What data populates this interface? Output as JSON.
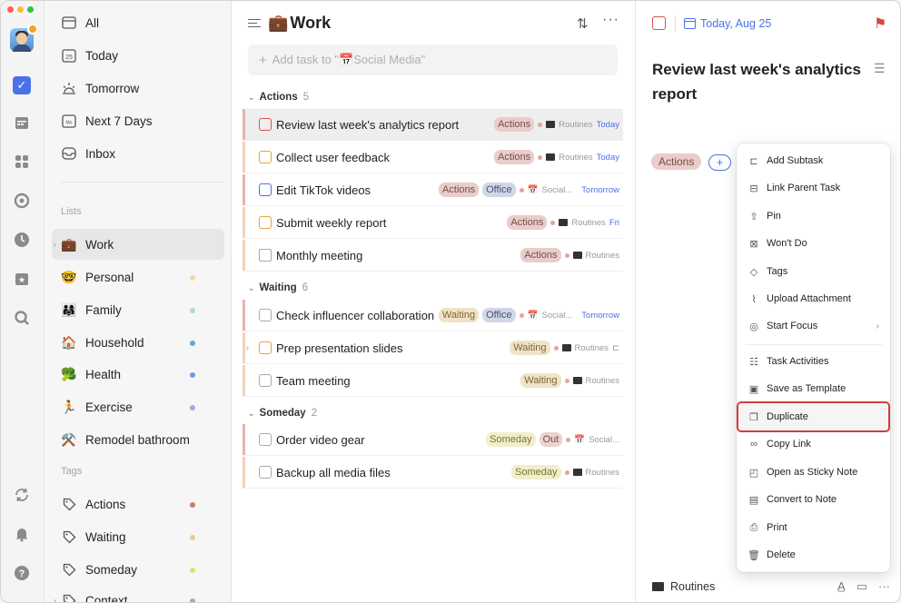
{
  "rail": {
    "icons": [
      "check-square-icon",
      "calendar-icon",
      "grid-icon",
      "focus-icon",
      "clock-icon",
      "calendar-star-icon",
      "search-icon",
      "sync-icon",
      "bell-icon",
      "help-icon"
    ],
    "active_color": "#4a72e8"
  },
  "sidebar": {
    "smart_lists": [
      {
        "label": "All",
        "icon": "tray-icon"
      },
      {
        "label": "Today",
        "icon": "calendar-25-icon"
      },
      {
        "label": "Tomorrow",
        "icon": "sunrise-icon"
      },
      {
        "label": "Next 7 Days",
        "icon": "calendar-week-icon"
      },
      {
        "label": "Inbox",
        "icon": "inbox-icon"
      }
    ],
    "lists_label": "Lists",
    "lists": [
      {
        "label": "Work",
        "emoji": "💼",
        "dot": ""
      },
      {
        "label": "Personal",
        "emoji": "🤓",
        "dot": "#f3d8a2"
      },
      {
        "label": "Family",
        "emoji": "👨‍👩‍👧",
        "dot": "#b8d8cf"
      },
      {
        "label": "Household",
        "emoji": "🏠",
        "dot": "#58a9d9"
      },
      {
        "label": "Health",
        "emoji": "🥦",
        "dot": "#6e9ce8"
      },
      {
        "label": "Exercise",
        "emoji": "🏃",
        "dot": "#b99de6"
      },
      {
        "label": "Remodel bathroom",
        "emoji": "⚒️",
        "dot": ""
      }
    ],
    "tags_label": "Tags",
    "tags": [
      {
        "label": "Actions",
        "dot": "#d47b70"
      },
      {
        "label": "Waiting",
        "dot": "#f0c98e"
      },
      {
        "label": "Someday",
        "dot": "#dde07a"
      },
      {
        "label": "Context",
        "dot": "#aaaaaa"
      }
    ]
  },
  "main": {
    "title": "Work",
    "title_emoji": "💼",
    "add_placeholder": "Add task to \"📅Social Media\"",
    "groups": [
      {
        "name": "Actions",
        "count": "5"
      },
      {
        "name": "Waiting",
        "count": "6"
      },
      {
        "name": "Someday",
        "count": "2"
      }
    ],
    "tasks": [
      {
        "title": "Review last week's analytics report",
        "tags": [
          "Actions"
        ],
        "project": "Routines",
        "due": "Today"
      },
      {
        "title": "Collect user feedback",
        "tags": [
          "Actions"
        ],
        "project": "Routines",
        "due": "Today"
      },
      {
        "title": "Edit TikTok videos",
        "tags": [
          "Actions",
          "Office"
        ],
        "project": "Social...",
        "due": "Tomorrow"
      },
      {
        "title": "Submit weekly report",
        "tags": [
          "Actions"
        ],
        "project": "Routines",
        "due": "Fri"
      },
      {
        "title": "Monthly meeting",
        "tags": [
          "Actions"
        ],
        "project": "Routines",
        "due": ""
      },
      {
        "title": "Check influencer collaboration",
        "tags": [
          "Waiting",
          "Office"
        ],
        "project": "Social...",
        "due": "Tomorrow"
      },
      {
        "title": "Prep presentation slides",
        "tags": [
          "Waiting"
        ],
        "project": "Routines",
        "due": ""
      },
      {
        "title": "Team meeting",
        "tags": [
          "Waiting"
        ],
        "project": "Routines",
        "due": ""
      },
      {
        "title": "Order video gear",
        "tags": [
          "Someday",
          "Out"
        ],
        "project": "Social...",
        "due": ""
      },
      {
        "title": "Backup all media files",
        "tags": [
          "Someday"
        ],
        "project": "Routines",
        "due": ""
      }
    ]
  },
  "detail": {
    "date": "Today, Aug 25",
    "title": "Review last week's analytics report",
    "tag": "Actions",
    "add_tag": "+",
    "project": "Routines",
    "flag_color": "#d9443d"
  },
  "menu": {
    "items": [
      {
        "label": "Add Subtask",
        "icon": "subtask-icon"
      },
      {
        "label": "Link Parent Task",
        "icon": "link-parent-icon"
      },
      {
        "label": "Pin",
        "icon": "pin-icon"
      },
      {
        "label": "Won't Do",
        "icon": "x-box-icon"
      },
      {
        "label": "Tags",
        "icon": "tag-icon"
      },
      {
        "label": "Upload Attachment",
        "icon": "paperclip-icon"
      },
      {
        "label": "Start Focus",
        "icon": "focus-icon"
      },
      {
        "label": "Task Activities",
        "icon": "activities-icon"
      },
      {
        "label": "Save as Template",
        "icon": "template-icon"
      },
      {
        "label": "Duplicate",
        "icon": "duplicate-icon"
      },
      {
        "label": "Copy Link",
        "icon": "link-icon"
      },
      {
        "label": "Open as Sticky Note",
        "icon": "sticky-note-icon"
      },
      {
        "label": "Convert to Note",
        "icon": "note-icon"
      },
      {
        "label": "Print",
        "icon": "print-icon"
      },
      {
        "label": "Delete",
        "icon": "trash-icon"
      }
    ],
    "highlight_color": "#d43c3c"
  }
}
